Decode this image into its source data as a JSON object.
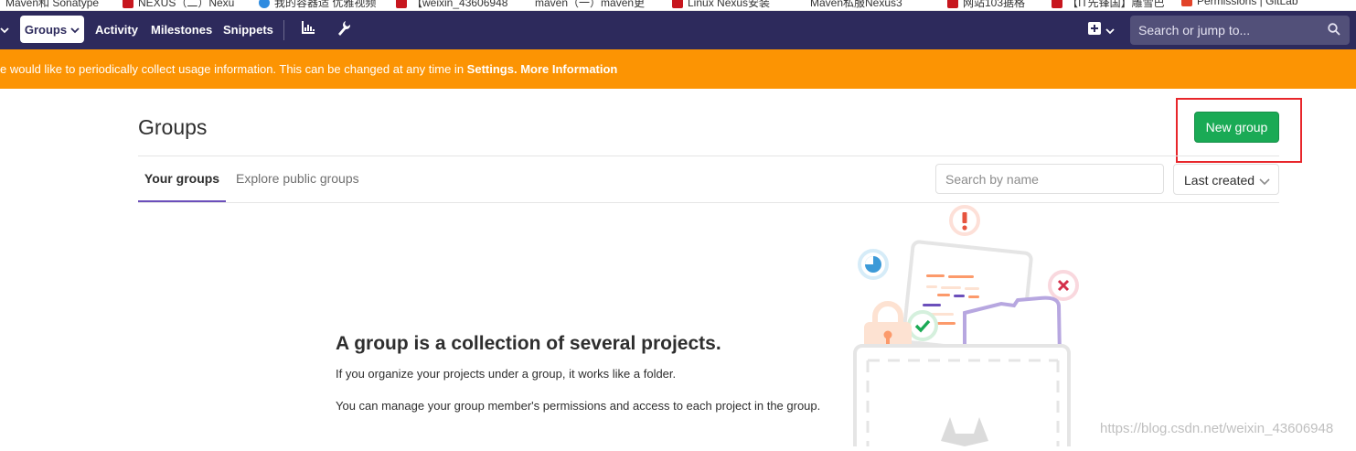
{
  "bookmarks": [
    {
      "label": "Maven和 Sonatype",
      "color": "#ffffff"
    },
    {
      "label": "NEXUS（二）Nexu",
      "color": "#c7161e"
    },
    {
      "label": "我的容器适 优雅视频",
      "color": "#2e8be0"
    },
    {
      "label": "【weixin_43606948",
      "color": "#c7161e"
    },
    {
      "label": "maven（一）maven更",
      "color": "#ffffff"
    },
    {
      "label": "Linux Nexus安装",
      "color": "#c7161e"
    },
    {
      "label": "Maven私服Nexus3",
      "color": "#ffffff"
    },
    {
      "label": "网站103据格",
      "color": "#c7161e"
    },
    {
      "label": "【IT先锋国】雕雪巴",
      "color": "#c7161e"
    },
    {
      "label": "Permissions | GitLab",
      "color": "#e24329"
    }
  ],
  "navbar": {
    "groups_label": "Groups",
    "links": [
      "Activity",
      "Milestones",
      "Snippets"
    ],
    "search_placeholder": "Search or jump to...",
    "bg_color": "#2d2a5c"
  },
  "banner": {
    "text": "e would like to periodically collect usage information. This can be changed at any time in",
    "settings_link": "Settings.",
    "more_link": "More Information",
    "bg_color": "#fc9403"
  },
  "page": {
    "title": "Groups",
    "new_group_button": "New group",
    "tabs": [
      "Your groups",
      "Explore public groups"
    ],
    "filter_placeholder": "Search by name",
    "sort_value": "Last created"
  },
  "empty_state": {
    "title": "A group is a collection of several projects.",
    "line1": "If you organize your projects under a group, it works like a folder.",
    "line2": "You can manage your group member's permissions and access to each project in the group."
  },
  "watermark": "https://blog.csdn.net/weixin_43606948"
}
